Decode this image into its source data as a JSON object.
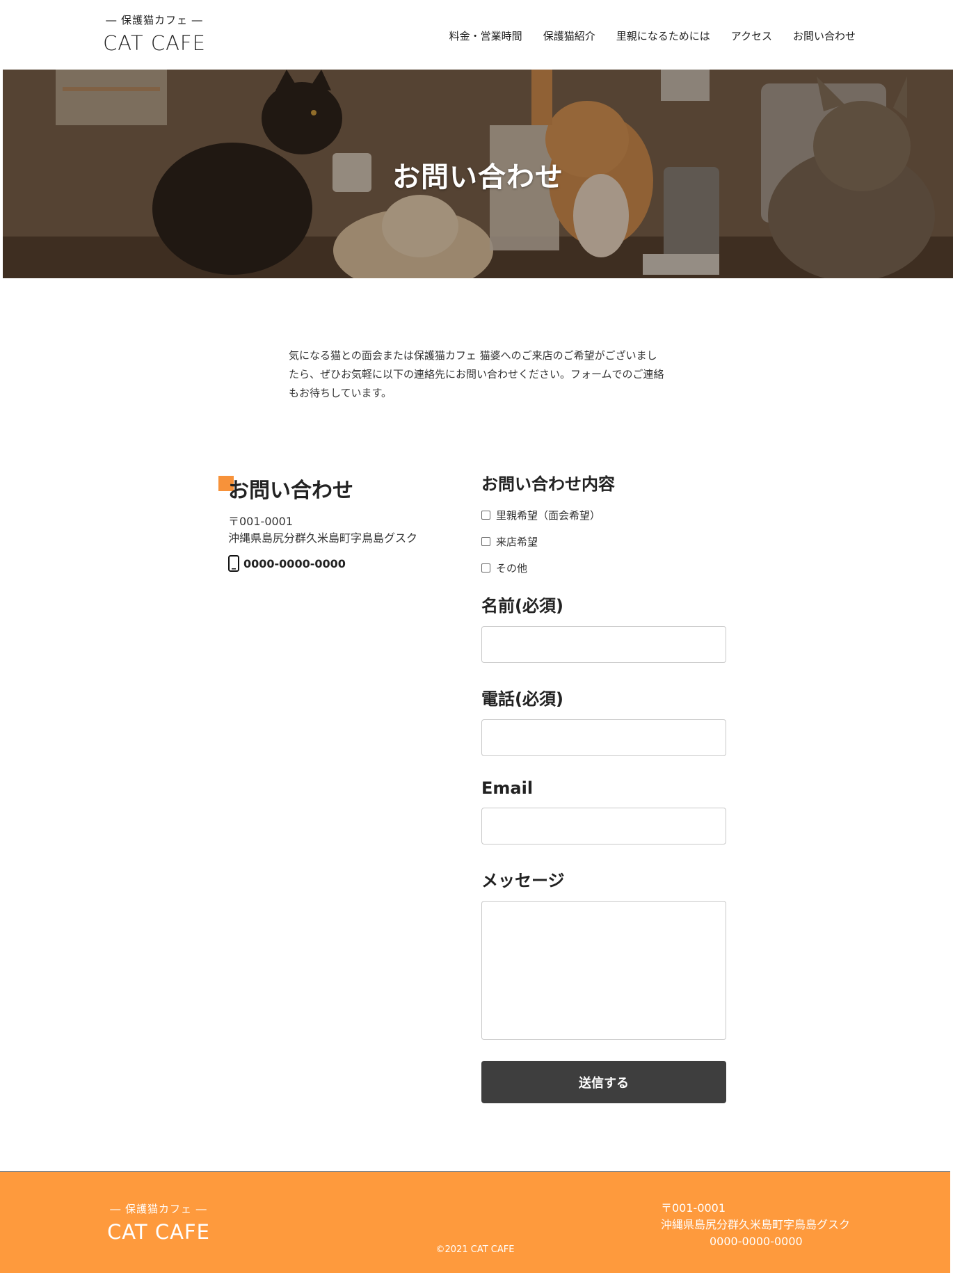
{
  "header": {
    "logo_sub": "― 保護猫カフェ ―",
    "logo_main": "CAT CAFE",
    "nav": [
      "料金・営業時間",
      "保護猫紹介",
      "里親になるためには",
      "アクセス",
      "お問い合わせ"
    ]
  },
  "hero": {
    "title": "お問い合わせ"
  },
  "intro": {
    "text": "気になる猫との面会または保護猫カフェ 猫婆へのご来店のご希望がございましたら、ぜひお気軽に以下の連絡先にお問い合わせください。フォームでのご連絡もお待ちしています。"
  },
  "contact": {
    "title": "お問い合わせ",
    "zip": "〒001-0001",
    "address": "沖縄県島尻分群久米島町字鳥島グスク",
    "phone": "0000-0000-0000",
    "accent_color": "#f7923a"
  },
  "form": {
    "inquiry_heading": "お問い合わせ内容",
    "options": [
      "里親希望（面会希望）",
      "来店希望",
      "その他"
    ],
    "name_label": "名前(必須)",
    "phone_label": "電話(必須)",
    "email_label": "Email",
    "message_label": "メッセージ",
    "submit_label": "送信する"
  },
  "footer": {
    "logo_sub": "― 保護猫カフェ ―",
    "logo_main": "CAT CAFE",
    "copyright": "©2021 CAT CAFE",
    "zip": "〒001-0001",
    "address": "沖縄県島尻分群久米島町字鳥島グスク",
    "phone": "0000-0000-0000",
    "bg_color": "#fe9a3d"
  }
}
